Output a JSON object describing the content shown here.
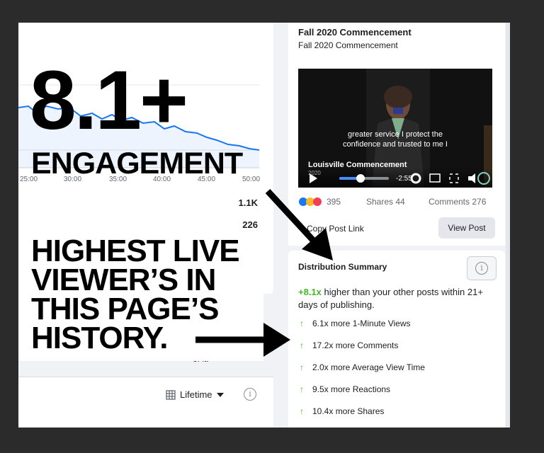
{
  "chart": {
    "ticks": [
      "25:00",
      "30:00",
      "35:00",
      "40:00",
      "45:00",
      "50:00"
    ],
    "line_color": "#1877f2"
  },
  "stats": {
    "value1": "1.1K",
    "value2": "226"
  },
  "left_bottom": {
    "partial_text": "of it.",
    "period": "Lifetime",
    "info": "i"
  },
  "post": {
    "title": "Fall 2020 Commencement",
    "subtitle": "Fall 2020 Commencement",
    "video": {
      "caption_line1": "greater service I protect the",
      "caption_line2": "confidence and trusted to me I",
      "label": "Louisville Commencement",
      "date": "2020",
      "time": "-2:55"
    },
    "reaction_count": "395",
    "shares": "Shares 44",
    "comments": "Comments 276",
    "copy_link": "Copy Post Link",
    "view_post": "View Post"
  },
  "distribution": {
    "title": "Distribution Summary",
    "highlight": "+8.1x",
    "summary": " higher than your other posts within 21+ days of publishing.",
    "metrics": [
      "6.1x more 1-Minute Views",
      "17.2x more Comments",
      "2.0x more Average View Time",
      "9.5x more Reactions",
      "10.4x more Shares"
    ],
    "accent": "#42b72a"
  },
  "overlay": {
    "big_number": "8.1+",
    "engagement": "ENGAGEMENT",
    "highest_lines": [
      "HIGHEST LIVE",
      "VIEWER’S IN",
      "THIS PAGE’S",
      "HISTORY."
    ]
  }
}
